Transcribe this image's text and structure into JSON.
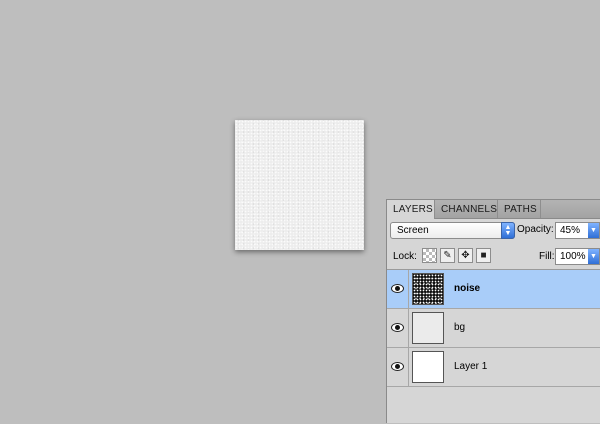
{
  "layers_panel": {
    "tabs": [
      {
        "label": "LAYERS",
        "active": true
      },
      {
        "label": "CHANNELS",
        "active": false
      },
      {
        "label": "PATHS",
        "active": false
      }
    ],
    "blend_mode": "Screen",
    "opacity_label": "Opacity:",
    "opacity_value": "45%",
    "lock_label": "Lock:",
    "fill_label": "Fill:",
    "fill_value": "100%",
    "layers": [
      {
        "name": "noise",
        "selected": true,
        "visible": true
      },
      {
        "name": "bg",
        "selected": false,
        "visible": true
      },
      {
        "name": "Layer 1",
        "selected": false,
        "visible": true
      }
    ]
  },
  "colors": {
    "workspace": "#bebebe",
    "selection": "#a9cdf9",
    "panel": "#d6d6d6"
  }
}
